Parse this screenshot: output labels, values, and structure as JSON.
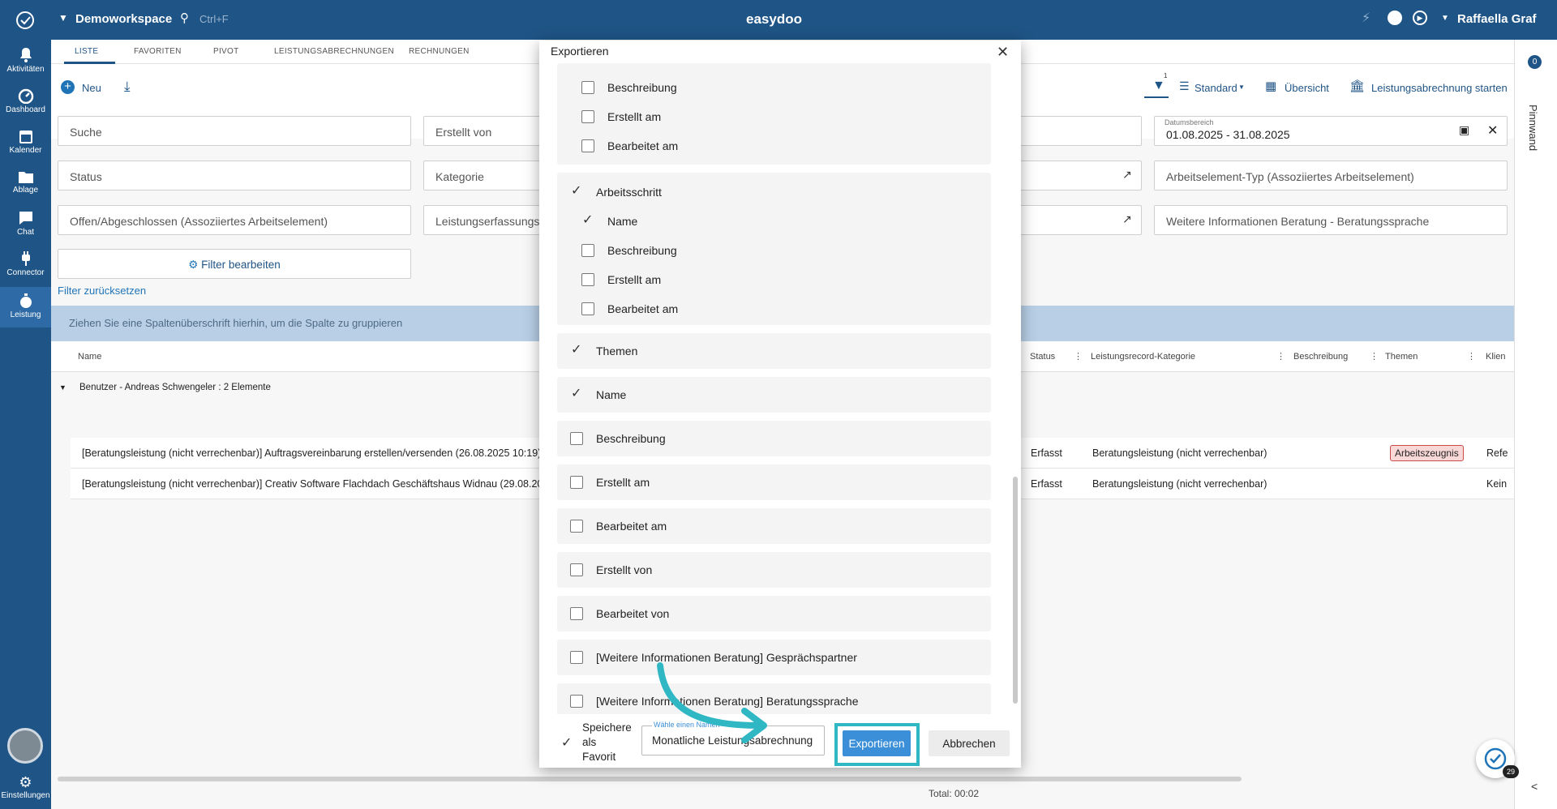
{
  "topbar": {
    "workspace": "Demoworkspace",
    "search_shortcut": "Ctrl+F",
    "app_title": "easydoo",
    "user_name": "Raffaella Graf"
  },
  "sidebar": {
    "items": [
      {
        "label": "Aktivitäten",
        "icon": "bell-icon"
      },
      {
        "label": "Dashboard",
        "icon": "gauge-icon"
      },
      {
        "label": "Kalender",
        "icon": "calendar-icon"
      },
      {
        "label": "Ablage",
        "icon": "folder-icon"
      },
      {
        "label": "Chat",
        "icon": "chat-icon"
      },
      {
        "label": "Connector",
        "icon": "plug-icon"
      },
      {
        "label": "Leistung",
        "icon": "stopwatch-icon"
      }
    ],
    "settings_label": "Einstellungen"
  },
  "tabs": [
    "LISTE",
    "FAVORITEN",
    "PIVOT",
    "LEISTUNGSABRECHNUNGEN",
    "RECHNUNGEN"
  ],
  "toolbar": {
    "new_label": "Neu",
    "filter_badge": "1",
    "view_label": "Standard",
    "overview_label": "Übersicht",
    "billing_label": "Leistungsabrechnung starten"
  },
  "filters": {
    "search": "Suche",
    "created_by": "Erstellt von",
    "status": "Status",
    "category": "Kategorie",
    "open_closed": "Offen/Abgeschlossen (Assoziiertes Arbeitselement)",
    "type": "Leistungserfassungsty",
    "date_label": "Datumsbereich",
    "date_value": "01.08.2025 - 31.08.2025",
    "element_type": "Arbeitselement-Typ (Assoziiertes Arbeitselement)",
    "language": "Weitere Informationen Beratung - Beratungssprache",
    "edit_filter": "Filter bearbeiten",
    "reset_filter": "Filter zurücksetzen"
  },
  "grid": {
    "group_hint": "Ziehen Sie eine Spaltenüberschrift hierhin, um die Spalte zu gruppieren",
    "columns": {
      "name": "Name",
      "status": "Status",
      "category": "Leistungsrecord-Kategorie",
      "description": "Beschreibung",
      "themes": "Themen",
      "client": "Klien"
    },
    "group_row": "Benutzer - Andreas Schwengeler : 2 Elemente",
    "rows": [
      {
        "name": "[Beratungsleistung (nicht verrechenbar)] Auftragsvereinbarung erstellen/versenden (26.08.2025 10:19)",
        "status": "Erfasst",
        "category": "Beratungsleistung (nicht verrechenbar)",
        "theme": "Arbeitszeugnis",
        "client": "Refe"
      },
      {
        "name": "[Beratungsleistung (nicht verrechenbar)] Creativ Software Flachdach Geschäftshaus Widnau (29.08.2025",
        "status": "Erfasst",
        "category": "Beratungsleistung (nicht verrechenbar)",
        "theme": "",
        "client": "Kein"
      }
    ],
    "total": "Total: 00:02"
  },
  "pinnwand": {
    "label": "Pinnwand",
    "badge": "0"
  },
  "help_badge": "29",
  "modal": {
    "title": "Exportieren",
    "card1": [
      {
        "label": "Beschreibung",
        "checked": false
      },
      {
        "label": "Erstellt am",
        "checked": false
      },
      {
        "label": "Bearbeitet am",
        "checked": false
      }
    ],
    "card2_header": {
      "label": "Arbeitsschritt",
      "checked": true
    },
    "card2": [
      {
        "label": "Name",
        "checked": true
      },
      {
        "label": "Beschreibung",
        "checked": false
      },
      {
        "label": "Erstellt am",
        "checked": false
      },
      {
        "label": "Bearbeitet am",
        "checked": false
      }
    ],
    "fields": [
      {
        "label": "Themen",
        "checked": true
      },
      {
        "label": "Name",
        "checked": true
      },
      {
        "label": "Beschreibung",
        "checked": false
      },
      {
        "label": "Erstellt am",
        "checked": false
      },
      {
        "label": "Bearbeitet am",
        "checked": false
      },
      {
        "label": "Erstellt von",
        "checked": false
      },
      {
        "label": "Bearbeitet von",
        "checked": false
      },
      {
        "label": "[Weitere Informationen Beratung] Gesprächspartner",
        "checked": false
      },
      {
        "label": "[Weitere Informationen Beratung] Beratungssprache",
        "checked": false
      }
    ],
    "save_favorite_label": [
      "Speichere",
      "als",
      "Favorit"
    ],
    "save_favorite_checked": true,
    "name_field_label": "Wähle einen Namen",
    "name_field_value": "Monatliche Leistungsabrechnung",
    "export_label": "Exportieren",
    "cancel_label": "Abbrechen"
  },
  "colors": {
    "brand": "#1f5486",
    "accent": "#3a8fd8",
    "highlight": "#2fb7c4",
    "tag_bg": "#f8d7d7",
    "tag_border": "#c94a4a"
  }
}
